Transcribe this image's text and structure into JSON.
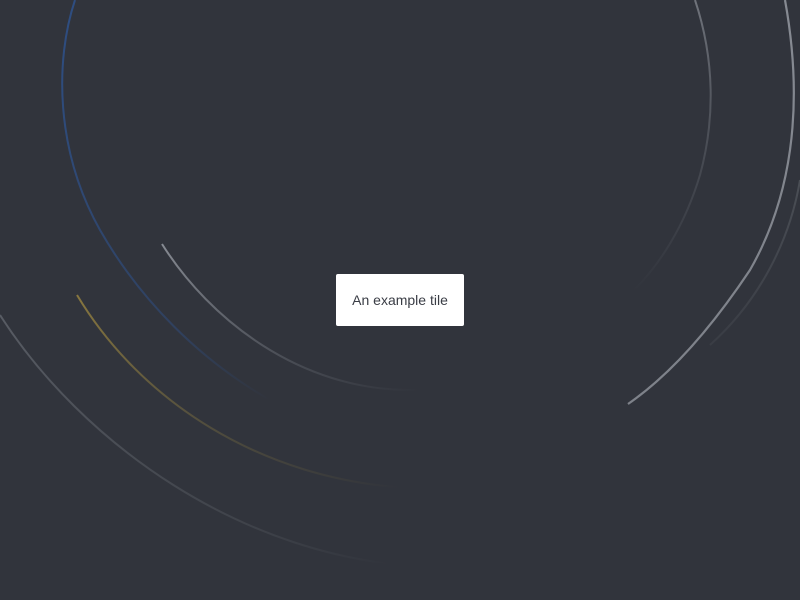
{
  "tile": {
    "label": "An example tile"
  },
  "colors": {
    "background": "#31343c",
    "tile_background": "#ffffff",
    "tile_text": "#3a3d45",
    "arc_blue": "#2e4f86",
    "arc_gold": "#8c7a3f",
    "arc_gray": "#8b8f97",
    "arc_dim": "#4d5158"
  }
}
